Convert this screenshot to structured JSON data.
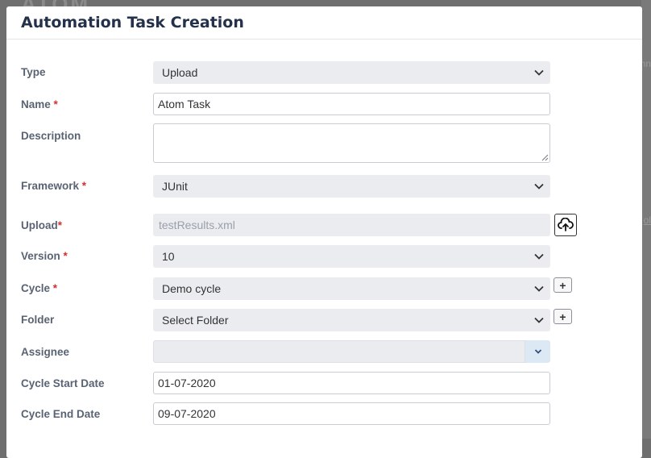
{
  "backdrop": {
    "heading": "ATOM",
    "fragment_1": "nn",
    "fragment_2": "ol"
  },
  "modal": {
    "title": "Automation Task Creation"
  },
  "form": {
    "type": {
      "label": "Type",
      "value": "Upload"
    },
    "name": {
      "label": "Name",
      "required_mark": "*",
      "value": "Atom Task"
    },
    "description": {
      "label": "Description",
      "value": ""
    },
    "framework": {
      "label": "Framework",
      "required_mark": "*",
      "value": "JUnit"
    },
    "upload": {
      "label": "Upload",
      "required_mark": "*",
      "placeholder": "testResults.xml",
      "button_icon": "cloud-upload-icon"
    },
    "version": {
      "label": "Version",
      "required_mark": "*",
      "value": "10"
    },
    "cycle": {
      "label": "Cycle",
      "required_mark": "*",
      "value": "Demo cycle",
      "add_label": "+"
    },
    "folder": {
      "label": "Folder",
      "value": "Select Folder",
      "add_label": "+"
    },
    "assignee": {
      "label": "Assignee",
      "value": ""
    },
    "cycle_start_date": {
      "label": "Cycle Start Date",
      "value": "01-07-2020"
    },
    "cycle_end_date": {
      "label": "Cycle End Date",
      "value": "09-07-2020"
    }
  },
  "colors": {
    "title": "#24314a",
    "required": "#d62f2f",
    "select_bg": "#ebecf0",
    "assignee_toggle_bg": "#dde8f5"
  }
}
